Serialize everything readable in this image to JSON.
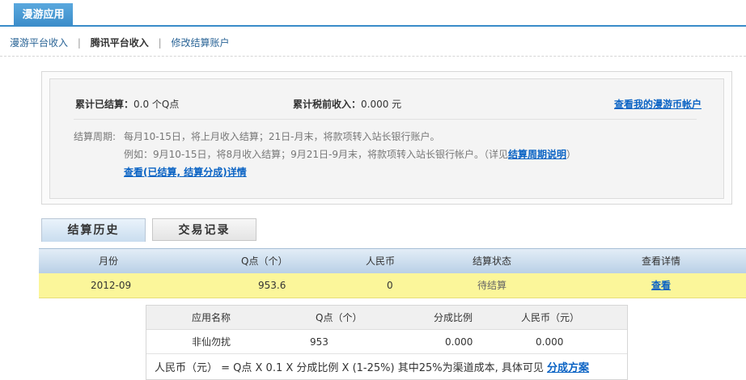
{
  "app_tab": "漫游应用",
  "sub_nav": {
    "items": [
      "漫游平台收入",
      "腾讯平台收入",
      "修改结算账户"
    ],
    "separator": "|"
  },
  "summary": {
    "settled_label": "累计已结算：",
    "settled_value": "0.0 个Q点",
    "pretax_label": "累计税前收入：",
    "pretax_value": "0.000 元",
    "account_link": "查看我的漫游币帐户",
    "period_label": "结算周期:",
    "period_line1": "每月10-15日，将上月收入结算；21日-月末，将款项转入站长银行账户。",
    "period_line2_prefix": "例如：9月10-15日，将8月收入结算；9月21日-9月末，将款项转入站长银行帐户。（详见",
    "period_line2_link": "结算周期说明",
    "period_line2_suffix": "）",
    "details_link": "查看(已结算, 结算分成)详情"
  },
  "tabs": {
    "history": "结算历史",
    "transactions": "交易记录"
  },
  "table": {
    "headers": [
      "月份",
      "Q点（个）",
      "人民币",
      "结算状态",
      "查看详情"
    ],
    "rows": [
      {
        "month": "2012-09",
        "qpoints": "953.6",
        "rmb": "0",
        "status": "待结算",
        "action": "查看"
      }
    ]
  },
  "detail": {
    "headers": [
      "应用名称",
      "Q点（个）",
      "分成比例",
      "人民币（元）"
    ],
    "rows": [
      {
        "app": "非仙勿扰",
        "qpoints": "953",
        "ratio": "0.000",
        "rmb": "0.000"
      }
    ],
    "formula_text": "人民币（元） = Q点 X 0.1 X 分成比例 X (1-25%)     其中25%为渠道成本, 具体可见",
    "formula_link": "分成方案"
  }
}
